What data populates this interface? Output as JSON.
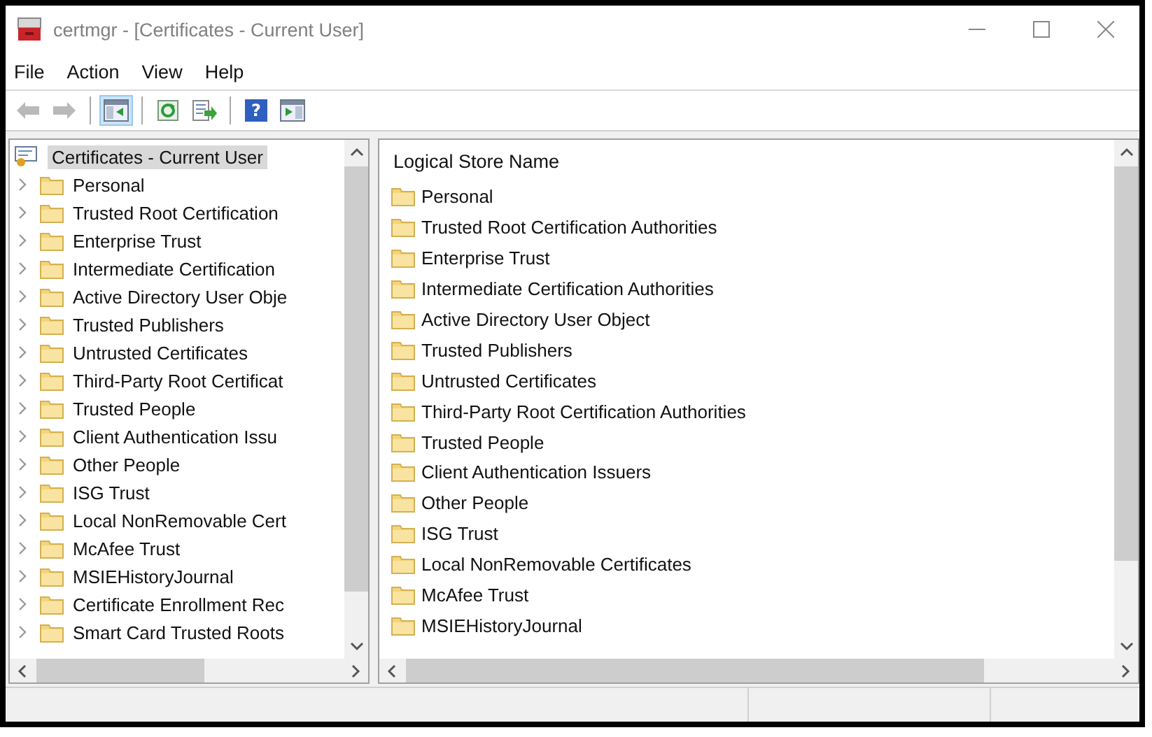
{
  "window": {
    "title": "certmgr - [Certificates - Current User]"
  },
  "menu": [
    "File",
    "Action",
    "View",
    "Help"
  ],
  "toolbar": [
    [
      {
        "kind": "back",
        "selected": false,
        "disabled": true
      },
      {
        "kind": "forward",
        "selected": false,
        "disabled": true
      }
    ],
    [
      {
        "kind": "console-tree",
        "selected": true,
        "disabled": false
      }
    ],
    [
      {
        "kind": "refresh",
        "selected": false,
        "disabled": false
      },
      {
        "kind": "export",
        "selected": false,
        "disabled": false
      }
    ],
    [
      {
        "kind": "help",
        "selected": false,
        "disabled": false,
        "glyph": "?"
      },
      {
        "kind": "action-pane",
        "selected": false,
        "disabled": false
      }
    ]
  ],
  "tree": {
    "label": "Certificates - Current User",
    "selected": true,
    "children": [
      {
        "label": "Personal",
        "expanded": false,
        "selected": false
      },
      {
        "label": "Trusted Root Certification",
        "expanded": false,
        "selected": false
      },
      {
        "label": "Enterprise Trust",
        "expanded": false,
        "selected": false
      },
      {
        "label": "Intermediate Certification",
        "expanded": false,
        "selected": false
      },
      {
        "label": "Active Directory User Obje",
        "expanded": false,
        "selected": false
      },
      {
        "label": "Trusted Publishers",
        "expanded": false,
        "selected": false
      },
      {
        "label": "Untrusted Certificates",
        "expanded": false,
        "selected": false
      },
      {
        "label": "Third-Party Root Certificat",
        "expanded": false,
        "selected": false
      },
      {
        "label": "Trusted People",
        "expanded": false,
        "selected": false
      },
      {
        "label": "Client Authentication Issu",
        "expanded": false,
        "selected": false
      },
      {
        "label": "Other People",
        "expanded": false,
        "selected": false
      },
      {
        "label": "ISG Trust",
        "expanded": false,
        "selected": false
      },
      {
        "label": "Local NonRemovable Cert",
        "expanded": false,
        "selected": false
      },
      {
        "label": "McAfee Trust",
        "expanded": false,
        "selected": false
      },
      {
        "label": "MSIEHistoryJournal",
        "expanded": false,
        "selected": false
      },
      {
        "label": "Certificate Enrollment Rec",
        "expanded": false,
        "selected": false
      },
      {
        "label": "Smart Card Trusted Roots",
        "expanded": false,
        "selected": false
      }
    ]
  },
  "list": {
    "column": "Logical Store Name",
    "items": [
      "Personal",
      "Trusted Root Certification Authorities",
      "Enterprise Trust",
      "Intermediate Certification Authorities",
      "Active Directory User Object",
      "Trusted Publishers",
      "Untrusted Certificates",
      "Third-Party Root Certification Authorities",
      "Trusted People",
      "Client Authentication Issuers",
      "Other People",
      "ISG Trust",
      "Local NonRemovable Certificates",
      "McAfee Trust",
      "MSIEHistoryJournal"
    ]
  }
}
